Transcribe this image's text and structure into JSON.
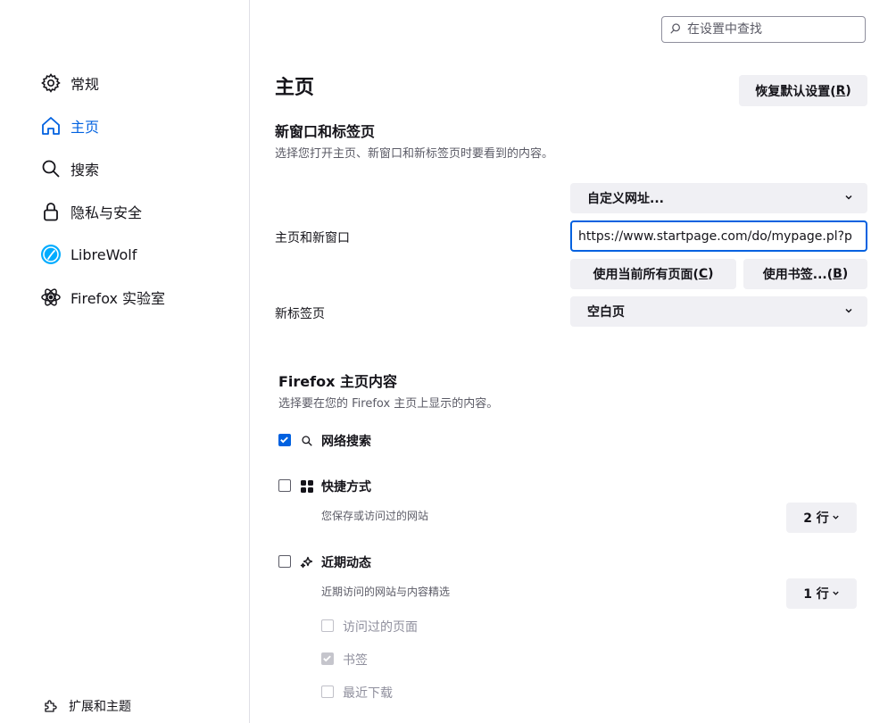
{
  "sidebar": {
    "items": [
      {
        "label": "常规",
        "icon": "gear-icon"
      },
      {
        "label": "主页",
        "icon": "home-icon"
      },
      {
        "label": "搜索",
        "icon": "search-icon"
      },
      {
        "label": "隐私与安全",
        "icon": "lock-icon"
      },
      {
        "label": "LibreWolf",
        "icon": "librewolf-icon"
      },
      {
        "label": "Firefox 实验室",
        "icon": "labs-icon"
      }
    ],
    "bottom_label": "扩展和主题"
  },
  "search": {
    "placeholder": "在设置中查找"
  },
  "page": {
    "title": "主页",
    "restore_btn_prefix": "恢复默认设置(",
    "restore_btn_key": "R",
    "restore_btn_suffix": ")"
  },
  "new_windows": {
    "heading": "新窗口和标签页",
    "desc": "选择您打开主页、新窗口和新标签页时要看到的内容。",
    "homepage_label": "主页和新窗口",
    "homepage_select": "自定义网址...",
    "url_value": "https://www.startpage.com/do/mypage.pl?p",
    "use_current_prefix": "使用当前所有页面(",
    "use_current_key": "C",
    "use_current_suffix": ")",
    "use_bookmark_prefix": "使用书签...(",
    "use_bookmark_key": "B",
    "use_bookmark_suffix": ")",
    "newtab_label": "新标签页",
    "newtab_select": "空白页"
  },
  "home_content": {
    "heading": "Firefox 主页内容",
    "desc": "选择要在您的 Firefox 主页上显示的内容。",
    "web_search": {
      "label": "网络搜索",
      "checked": true
    },
    "shortcuts": {
      "label": "快捷方式",
      "desc": "您保存或访问过的网站",
      "rows": "2 行",
      "checked": false
    },
    "recent": {
      "label": "近期动态",
      "desc": "近期访问的网站与内容精选",
      "rows": "1 行",
      "checked": false,
      "sub": [
        {
          "label": "访问过的页面",
          "checked": false
        },
        {
          "label": "书签",
          "checked": true
        },
        {
          "label": "最近下载",
          "checked": false
        }
      ]
    }
  },
  "colors": {
    "accent": "#0061e0",
    "button_bg": "#f0f0f4",
    "text": "#15141a",
    "muted": "#5b5b66"
  }
}
